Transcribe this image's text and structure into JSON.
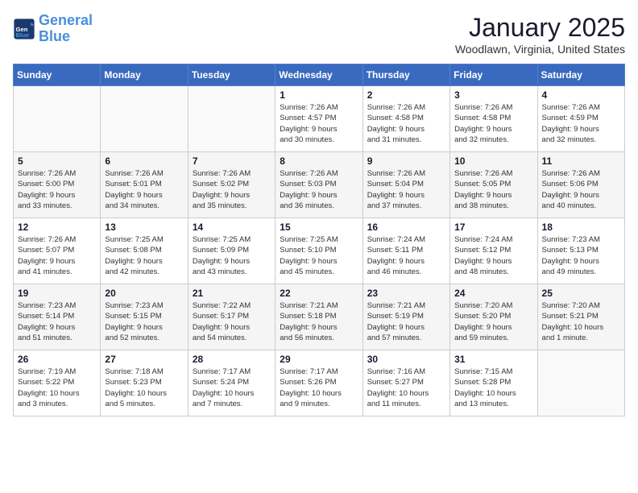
{
  "header": {
    "logo_line1": "General",
    "logo_line2": "Blue",
    "title": "January 2025",
    "subtitle": "Woodlawn, Virginia, United States"
  },
  "weekdays": [
    "Sunday",
    "Monday",
    "Tuesday",
    "Wednesday",
    "Thursday",
    "Friday",
    "Saturday"
  ],
  "weeks": [
    [
      {
        "num": "",
        "info": ""
      },
      {
        "num": "",
        "info": ""
      },
      {
        "num": "",
        "info": ""
      },
      {
        "num": "1",
        "info": "Sunrise: 7:26 AM\nSunset: 4:57 PM\nDaylight: 9 hours\nand 30 minutes."
      },
      {
        "num": "2",
        "info": "Sunrise: 7:26 AM\nSunset: 4:58 PM\nDaylight: 9 hours\nand 31 minutes."
      },
      {
        "num": "3",
        "info": "Sunrise: 7:26 AM\nSunset: 4:58 PM\nDaylight: 9 hours\nand 32 minutes."
      },
      {
        "num": "4",
        "info": "Sunrise: 7:26 AM\nSunset: 4:59 PM\nDaylight: 9 hours\nand 32 minutes."
      }
    ],
    [
      {
        "num": "5",
        "info": "Sunrise: 7:26 AM\nSunset: 5:00 PM\nDaylight: 9 hours\nand 33 minutes."
      },
      {
        "num": "6",
        "info": "Sunrise: 7:26 AM\nSunset: 5:01 PM\nDaylight: 9 hours\nand 34 minutes."
      },
      {
        "num": "7",
        "info": "Sunrise: 7:26 AM\nSunset: 5:02 PM\nDaylight: 9 hours\nand 35 minutes."
      },
      {
        "num": "8",
        "info": "Sunrise: 7:26 AM\nSunset: 5:03 PM\nDaylight: 9 hours\nand 36 minutes."
      },
      {
        "num": "9",
        "info": "Sunrise: 7:26 AM\nSunset: 5:04 PM\nDaylight: 9 hours\nand 37 minutes."
      },
      {
        "num": "10",
        "info": "Sunrise: 7:26 AM\nSunset: 5:05 PM\nDaylight: 9 hours\nand 38 minutes."
      },
      {
        "num": "11",
        "info": "Sunrise: 7:26 AM\nSunset: 5:06 PM\nDaylight: 9 hours\nand 40 minutes."
      }
    ],
    [
      {
        "num": "12",
        "info": "Sunrise: 7:26 AM\nSunset: 5:07 PM\nDaylight: 9 hours\nand 41 minutes."
      },
      {
        "num": "13",
        "info": "Sunrise: 7:25 AM\nSunset: 5:08 PM\nDaylight: 9 hours\nand 42 minutes."
      },
      {
        "num": "14",
        "info": "Sunrise: 7:25 AM\nSunset: 5:09 PM\nDaylight: 9 hours\nand 43 minutes."
      },
      {
        "num": "15",
        "info": "Sunrise: 7:25 AM\nSunset: 5:10 PM\nDaylight: 9 hours\nand 45 minutes."
      },
      {
        "num": "16",
        "info": "Sunrise: 7:24 AM\nSunset: 5:11 PM\nDaylight: 9 hours\nand 46 minutes."
      },
      {
        "num": "17",
        "info": "Sunrise: 7:24 AM\nSunset: 5:12 PM\nDaylight: 9 hours\nand 48 minutes."
      },
      {
        "num": "18",
        "info": "Sunrise: 7:23 AM\nSunset: 5:13 PM\nDaylight: 9 hours\nand 49 minutes."
      }
    ],
    [
      {
        "num": "19",
        "info": "Sunrise: 7:23 AM\nSunset: 5:14 PM\nDaylight: 9 hours\nand 51 minutes."
      },
      {
        "num": "20",
        "info": "Sunrise: 7:23 AM\nSunset: 5:15 PM\nDaylight: 9 hours\nand 52 minutes."
      },
      {
        "num": "21",
        "info": "Sunrise: 7:22 AM\nSunset: 5:17 PM\nDaylight: 9 hours\nand 54 minutes."
      },
      {
        "num": "22",
        "info": "Sunrise: 7:21 AM\nSunset: 5:18 PM\nDaylight: 9 hours\nand 56 minutes."
      },
      {
        "num": "23",
        "info": "Sunrise: 7:21 AM\nSunset: 5:19 PM\nDaylight: 9 hours\nand 57 minutes."
      },
      {
        "num": "24",
        "info": "Sunrise: 7:20 AM\nSunset: 5:20 PM\nDaylight: 9 hours\nand 59 minutes."
      },
      {
        "num": "25",
        "info": "Sunrise: 7:20 AM\nSunset: 5:21 PM\nDaylight: 10 hours\nand 1 minute."
      }
    ],
    [
      {
        "num": "26",
        "info": "Sunrise: 7:19 AM\nSunset: 5:22 PM\nDaylight: 10 hours\nand 3 minutes."
      },
      {
        "num": "27",
        "info": "Sunrise: 7:18 AM\nSunset: 5:23 PM\nDaylight: 10 hours\nand 5 minutes."
      },
      {
        "num": "28",
        "info": "Sunrise: 7:17 AM\nSunset: 5:24 PM\nDaylight: 10 hours\nand 7 minutes."
      },
      {
        "num": "29",
        "info": "Sunrise: 7:17 AM\nSunset: 5:26 PM\nDaylight: 10 hours\nand 9 minutes."
      },
      {
        "num": "30",
        "info": "Sunrise: 7:16 AM\nSunset: 5:27 PM\nDaylight: 10 hours\nand 11 minutes."
      },
      {
        "num": "31",
        "info": "Sunrise: 7:15 AM\nSunset: 5:28 PM\nDaylight: 10 hours\nand 13 minutes."
      },
      {
        "num": "",
        "info": ""
      }
    ]
  ]
}
